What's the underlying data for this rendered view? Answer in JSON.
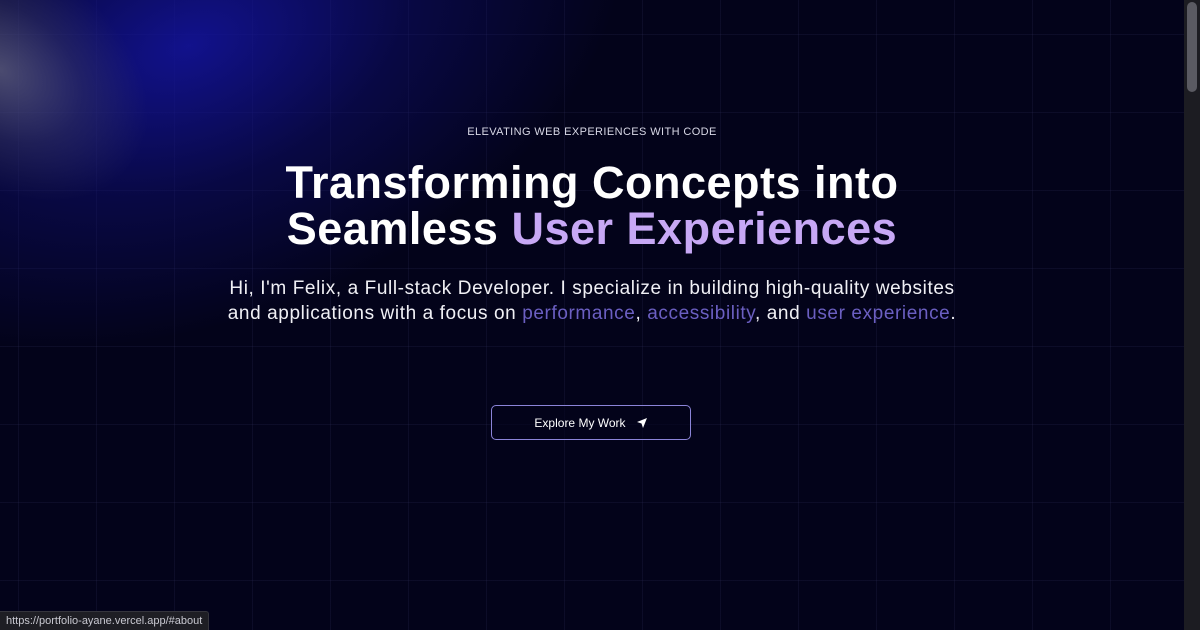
{
  "hero": {
    "eyebrow": "ELEVATING WEB EXPERIENCES WITH CODE",
    "headline_line1": "Transforming Concepts into",
    "headline_line2_plain": "Seamless",
    "headline_line2_accent": "User Experiences",
    "intro_part1": "Hi, I'm Felix, a Full-stack Developer. I specialize in building high-quality websites and applications with a focus on",
    "intro_highlight1": "performance",
    "intro_sep1": ",",
    "intro_highlight2": "accessibility",
    "intro_sep2": ", and",
    "intro_highlight3": "user experience",
    "intro_end": "."
  },
  "cta": {
    "label": "Explore My Work",
    "icon": "navigation-arrow-icon"
  },
  "status_bar": {
    "url": "https://portfolio-ayane.vercel.app/#about"
  },
  "colors": {
    "background": "#03031a",
    "accent_purple": "#c7a8f5",
    "highlight_indigo": "#6b5fc2",
    "button_border": "#8b84d8"
  }
}
